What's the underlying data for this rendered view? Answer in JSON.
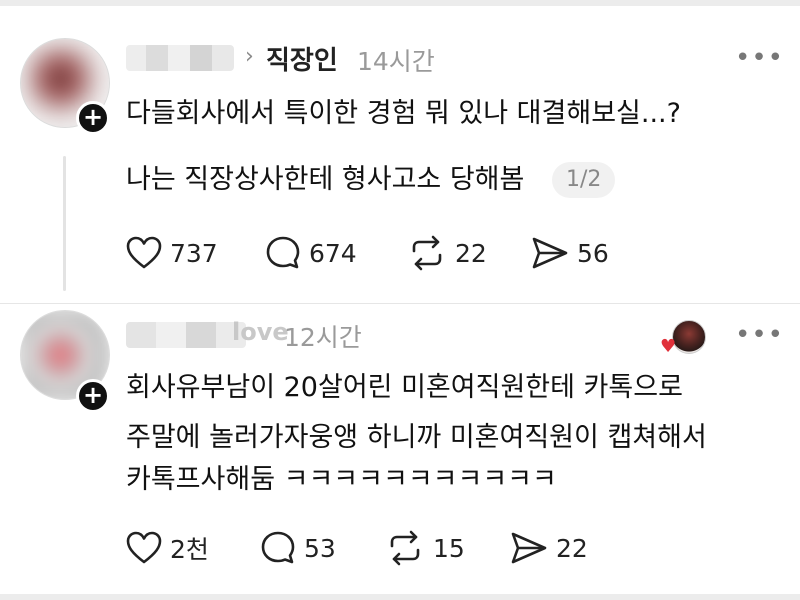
{
  "posts": [
    {
      "community": "직장인",
      "time": "14시간",
      "lines": [
        "다들회사에서 특이한 경험 뭐 있나 대결해보실...?"
      ],
      "reply": {
        "text": "나는 직장상사한테 형사고소 당해봄",
        "page": "1/2"
      },
      "actions": {
        "likes": "737",
        "comments": "674",
        "reposts": "22",
        "shares": "56"
      }
    },
    {
      "username_visible": "love",
      "time": "12시간",
      "lines": [
        "회사유부남이 20살어린 미혼여직원한테 카톡으로",
        "주말에 놀러가자웅앵 하니까 미혼여직원이 캡쳐해서",
        "카톡프사해둠 ㅋㅋㅋㅋㅋㅋㅋㅋㅋㅋㅋ"
      ],
      "actions": {
        "likes": "2천",
        "comments": "53",
        "reposts": "15",
        "shares": "22"
      }
    }
  ],
  "icons": {
    "more": "more-dots-icon",
    "like": "heart-icon",
    "comment": "speech-bubble-icon",
    "repost": "repost-arrows-icon",
    "share": "paper-plane-icon",
    "follow": "plus-icon"
  },
  "colors": {
    "text": "#111111",
    "muted": "#9a9a9a",
    "badge": "#111111",
    "heart": "#e0303a"
  }
}
